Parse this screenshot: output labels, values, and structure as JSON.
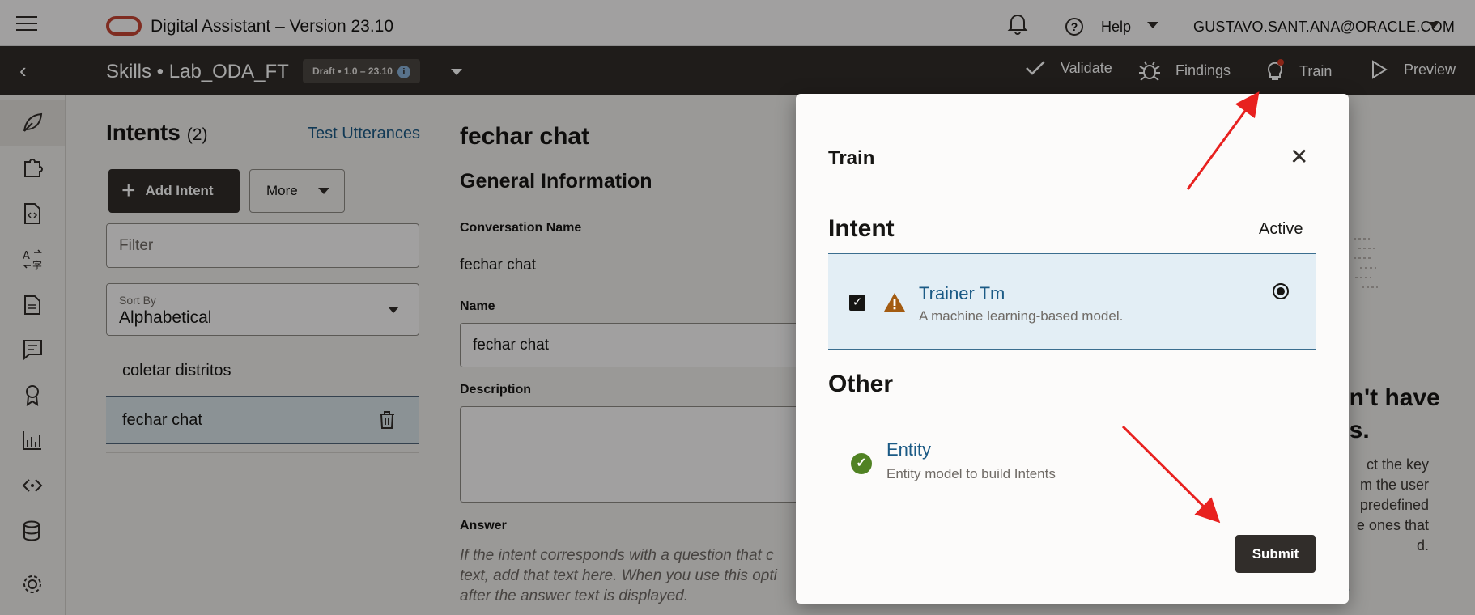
{
  "topbar": {
    "app_title": "Digital Assistant – Version 23.10",
    "help_label": "Help",
    "user": "GUSTAVO.SANT.ANA@ORACLE.COM"
  },
  "skillbar": {
    "title": "Skills • Lab_ODA_FT",
    "draft_badge": "Draft • 1.0 – 23.10",
    "actions": {
      "validate": "Validate",
      "findings": "Findings",
      "train": "Train",
      "preview": "Preview"
    }
  },
  "rail": {
    "items": [
      "leaf-icon",
      "puzzle-icon",
      "code-file-icon",
      "translate-icon",
      "document-icon",
      "chat-icon",
      "badge-icon",
      "analytics-icon",
      "channels-icon",
      "database-icon",
      "settings-icon"
    ]
  },
  "intents": {
    "title": "Intents",
    "count": "(2)",
    "test_utterances": "Test Utterances",
    "add_intent": "Add Intent",
    "more": "More",
    "filter_placeholder": "Filter",
    "sort_label": "Sort By",
    "sort_value": "Alphabetical",
    "items": [
      {
        "label": "coletar distritos"
      },
      {
        "label": "fechar chat"
      }
    ]
  },
  "main": {
    "title": "fechar chat",
    "section": "General Information",
    "conversation_name_label": "Conversation Name",
    "conversation_name_value": "fechar chat",
    "name_label": "Name",
    "name_value": "fechar chat",
    "description_label": "Description",
    "answer_label": "Answer",
    "answer_help_lines": [
      "If the intent corresponds with a question that c",
      "text, add that text here. When you use this opti",
      "after the answer text is displayed."
    ],
    "right_fragment_lines": [
      "sn't have",
      "es."
    ],
    "right_fragment_body_lines": [
      "ct the key",
      "m the user",
      "predefined",
      "e ones that",
      "d."
    ],
    "right_fragment_link": "e"
  },
  "dialog": {
    "title": "Train",
    "intent_heading": "Intent",
    "active_label": "Active",
    "option": {
      "name": "Trainer Tm",
      "description": "A machine learning-based model."
    },
    "other_heading": "Other",
    "entity": {
      "name": "Entity",
      "description": "Entity model to build Intents"
    },
    "submit": "Submit"
  },
  "colors": {
    "header_dark": "#312d2a",
    "brand_red": "#c74634",
    "link_blue": "#1b5a85",
    "selected_bg": "#e3eef5",
    "success_green": "#508223",
    "warning_orange": "#a35b11",
    "annotation_red": "#e8211f"
  }
}
